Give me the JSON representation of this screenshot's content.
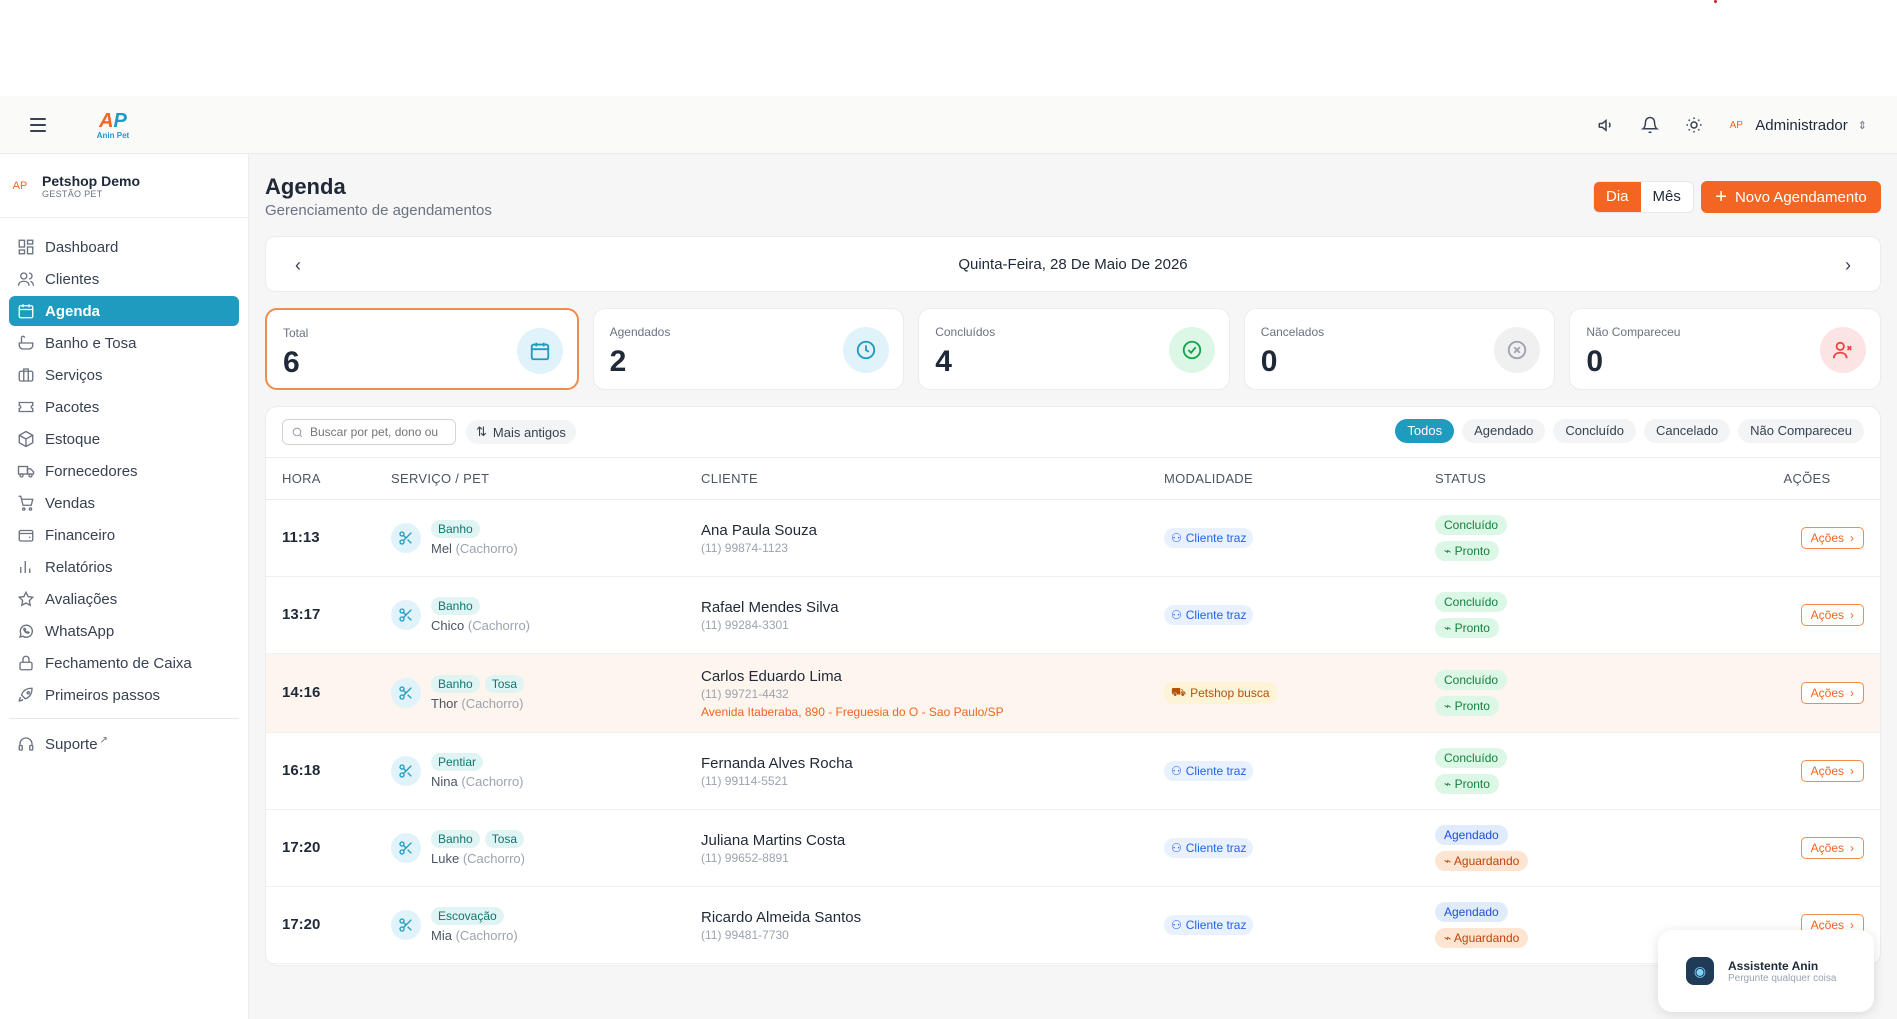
{
  "header": {
    "logo_text": "Anin Pet",
    "user_name": "Administrador"
  },
  "sidebar": {
    "store_name": "Petshop Demo",
    "store_sub": "GESTÃO PET",
    "items": [
      {
        "label": "Dashboard",
        "icon": "dashboard-icon"
      },
      {
        "label": "Clientes",
        "icon": "users-icon"
      },
      {
        "label": "Agenda",
        "icon": "calendar-icon"
      },
      {
        "label": "Banho e Tosa",
        "icon": "bath-icon"
      },
      {
        "label": "Serviços",
        "icon": "briefcase-icon"
      },
      {
        "label": "Pacotes",
        "icon": "ticket-icon"
      },
      {
        "label": "Estoque",
        "icon": "box-icon"
      },
      {
        "label": "Fornecedores",
        "icon": "truck-icon"
      },
      {
        "label": "Vendas",
        "icon": "cart-icon"
      },
      {
        "label": "Financeiro",
        "icon": "wallet-icon"
      },
      {
        "label": "Relatórios",
        "icon": "chart-icon"
      },
      {
        "label": "Avaliações",
        "icon": "star-icon"
      },
      {
        "label": "WhatsApp",
        "icon": "whatsapp-icon"
      },
      {
        "label": "Fechamento de Caixa",
        "icon": "lock-icon"
      },
      {
        "label": "Primeiros passos",
        "icon": "rocket-icon"
      }
    ],
    "support_label": "Suporte"
  },
  "page": {
    "title": "Agenda",
    "subtitle": "Gerenciamento de agendamentos",
    "view_day": "Dia",
    "view_month": "Mês",
    "new_button": "Novo Agendamento",
    "date_label": "Quinta-Feira, 28 De Maio De 2026"
  },
  "stats": [
    {
      "label": "Total",
      "value": "6",
      "icon": "calendar-icon",
      "color": "#1e9bbf"
    },
    {
      "label": "Agendados",
      "value": "2",
      "icon": "clock-icon",
      "color": "#1e9bbf"
    },
    {
      "label": "Concluídos",
      "value": "4",
      "icon": "check-circle-icon",
      "color": "#16a34a"
    },
    {
      "label": "Cancelados",
      "value": "0",
      "icon": "x-circle-icon",
      "color": "#9ca3af"
    },
    {
      "label": "Não Compareceu",
      "value": "0",
      "icon": "user-x-icon",
      "color": "#ef4444"
    }
  ],
  "filters": {
    "search_placeholder": "Buscar por pet, dono ou",
    "sort_label": "Mais antigos",
    "status_chips": [
      "Todos",
      "Agendado",
      "Concluído",
      "Cancelado",
      "Não Compareceu"
    ]
  },
  "table": {
    "headers": [
      "HORA",
      "SERVIÇO / PET",
      "CLIENTE",
      "MODALIDADE",
      "STATUS",
      "AÇÕES"
    ],
    "rows": [
      {
        "hora": "11:13",
        "services": [
          "Banho"
        ],
        "pet": "Mel",
        "species": "(Cachorro)",
        "client": "Ana Paula Souza",
        "phone": "(11) 99874-1123",
        "address": "",
        "mode": "Cliente traz",
        "status": "Concluído",
        "sub_status": "Pronto",
        "action": "Ações"
      },
      {
        "hora": "13:17",
        "services": [
          "Banho"
        ],
        "pet": "Chico",
        "species": "(Cachorro)",
        "client": "Rafael Mendes Silva",
        "phone": "(11) 99284-3301",
        "address": "",
        "mode": "Cliente traz",
        "status": "Concluído",
        "sub_status": "Pronto",
        "action": "Ações"
      },
      {
        "hora": "14:16",
        "services": [
          "Banho",
          "Tosa"
        ],
        "pet": "Thor",
        "species": "(Cachorro)",
        "client": "Carlos Eduardo Lima",
        "phone": "(11) 99721-4432",
        "address": "Avenida Itaberaba, 890 - Freguesia do O - Sao Paulo/SP",
        "mode": "Petshop busca",
        "status": "Concluído",
        "sub_status": "Pronto",
        "action": "Ações"
      },
      {
        "hora": "16:18",
        "services": [
          "Pentiar"
        ],
        "pet": "Nina",
        "species": "(Cachorro)",
        "client": "Fernanda Alves Rocha",
        "phone": "(11) 99114-5521",
        "address": "",
        "mode": "Cliente traz",
        "status": "Concluído",
        "sub_status": "Pronto",
        "action": "Ações"
      },
      {
        "hora": "17:20",
        "services": [
          "Banho",
          "Tosa"
        ],
        "pet": "Luke",
        "species": "(Cachorro)",
        "client": "Juliana Martins Costa",
        "phone": "(11) 99652-8891",
        "address": "",
        "mode": "Cliente traz",
        "status": "Agendado",
        "sub_status": "Aguardando",
        "action": "Ações"
      },
      {
        "hora": "17:20",
        "services": [
          "Escovação"
        ],
        "pet": "Mia",
        "species": "(Cachorro)",
        "client": "Ricardo Almeida Santos",
        "phone": "(11) 99481-7730",
        "address": "",
        "mode": "Cliente traz",
        "status": "Agendado",
        "sub_status": "Aguardando",
        "action": "Ações"
      }
    ]
  },
  "assistant": {
    "name": "Assistente Anin",
    "subtitle": "Pergunte qualquer coisa"
  }
}
